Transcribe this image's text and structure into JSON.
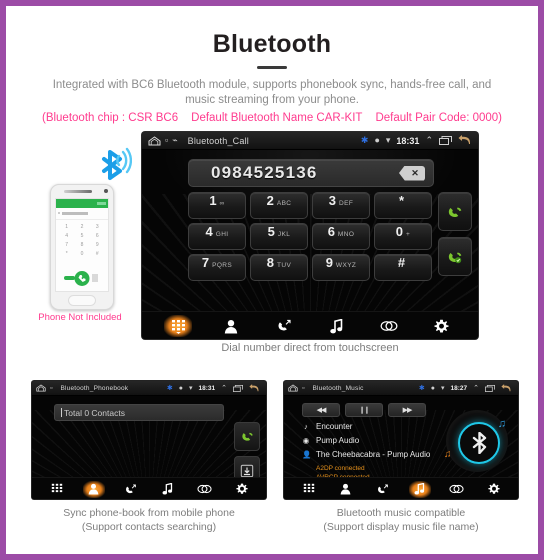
{
  "theme": {
    "border_color": "#9c4ca6",
    "accent_pink": "#ff3b8e",
    "accent_orange": "#e8921c",
    "accent_cyan": "#1fc8e8",
    "call_green": "#76c442"
  },
  "header": {
    "title": "Bluetooth",
    "subtitle": "Integrated with BC6 Bluetooth module, supports phonebook sync, hands-free call, and music streaming from your phone.",
    "note_chip": "(Bluetooth chip : CSR BC6",
    "note_name": "Default Bluetooth Name CAR-KIT",
    "note_pair": "Default Pair Code: 0000)"
  },
  "phone_illustration": {
    "caption": "Phone Not Included",
    "bt_icon": "bluetooth-icon",
    "signal_icon": "wireless-signal-icon",
    "keys": [
      "1",
      "2",
      "3",
      "4",
      "5",
      "6",
      "7",
      "8",
      "9",
      "*",
      "0",
      "#"
    ]
  },
  "dialer": {
    "statusbar": {
      "home_icon": "home-icon",
      "sd_icon": "sd-card-icon",
      "usb_icon": "usb-icon",
      "title": "Bluetooth_Call",
      "bt_icon": "bluetooth-icon",
      "dot_icon": "status-dot-icon",
      "wifi_icon": "signal-icon",
      "time": "18:31",
      "up_icon": "chevron-up-icon",
      "recent_icon": "recent-apps-icon",
      "back_icon": "back-arrow-icon"
    },
    "number": "0984525136",
    "backspace_icon": "backspace-icon",
    "keys": [
      {
        "digit": "1",
        "letters": "∞"
      },
      {
        "digit": "2",
        "letters": "ABC"
      },
      {
        "digit": "3",
        "letters": "DEF"
      },
      {
        "digit": "*",
        "letters": ""
      },
      {
        "digit": "4",
        "letters": "GHI"
      },
      {
        "digit": "5",
        "letters": "JKL"
      },
      {
        "digit": "6",
        "letters": "MNO"
      },
      {
        "digit": "0",
        "letters": "+"
      },
      {
        "digit": "7",
        "letters": "PQRS"
      },
      {
        "digit": "8",
        "letters": "TUV"
      },
      {
        "digit": "9",
        "letters": "WXYZ"
      },
      {
        "digit": "#",
        "letters": ""
      }
    ],
    "call_button": "call-icon",
    "answer_button": "answer-call-icon",
    "navbar": [
      {
        "name": "keypad",
        "icon": "keypad-icon",
        "active": true
      },
      {
        "name": "contacts",
        "icon": "contacts-icon",
        "active": false
      },
      {
        "name": "call-history",
        "icon": "call-history-icon",
        "active": false
      },
      {
        "name": "music",
        "icon": "music-note-icon",
        "active": false
      },
      {
        "name": "pair",
        "icon": "link-icon",
        "active": false
      },
      {
        "name": "settings",
        "icon": "gear-icon",
        "active": false
      }
    ],
    "caption": "Dial number direct from touchscreen"
  },
  "phonebook": {
    "statusbar": {
      "title": "Bluetooth_Phonebook",
      "time": "18:31"
    },
    "search_value": "Total 0 Contacts",
    "call_button": "call-icon",
    "download_button": "download-contacts-icon",
    "navbar": [
      {
        "name": "keypad",
        "icon": "keypad-icon",
        "active": false
      },
      {
        "name": "contacts",
        "icon": "contacts-icon",
        "active": true
      },
      {
        "name": "call-history",
        "icon": "call-history-icon",
        "active": false
      },
      {
        "name": "music",
        "icon": "music-note-icon",
        "active": false
      },
      {
        "name": "pair",
        "icon": "link-icon",
        "active": false
      },
      {
        "name": "settings",
        "icon": "gear-icon",
        "active": false
      }
    ],
    "caption_line1": "Sync phone-book from mobile phone",
    "caption_line2": "(Support contacts searching)"
  },
  "music": {
    "statusbar": {
      "title": "Bluetooth_Music",
      "time": "18:27"
    },
    "transport": {
      "prev": "◀◀",
      "pause": "❙❙",
      "next": "▶▶"
    },
    "track": "Encounter",
    "album": "Pump Audio",
    "artist": "The Cheebacabra - Pump Audio",
    "status_a2dp": "A2DP connected",
    "status_avrcp": "AVRCP connected",
    "disc_icon": "bluetooth-disc-icon",
    "navbar": [
      {
        "name": "keypad",
        "icon": "keypad-icon",
        "active": false
      },
      {
        "name": "contacts",
        "icon": "contacts-icon",
        "active": false
      },
      {
        "name": "call-history",
        "icon": "call-history-icon",
        "active": false
      },
      {
        "name": "music",
        "icon": "music-note-icon",
        "active": true
      },
      {
        "name": "pair",
        "icon": "link-icon",
        "active": false
      },
      {
        "name": "settings",
        "icon": "gear-icon",
        "active": false
      }
    ],
    "caption_line1": "Bluetooth music compatible",
    "caption_line2": "(Support display music file name)"
  }
}
